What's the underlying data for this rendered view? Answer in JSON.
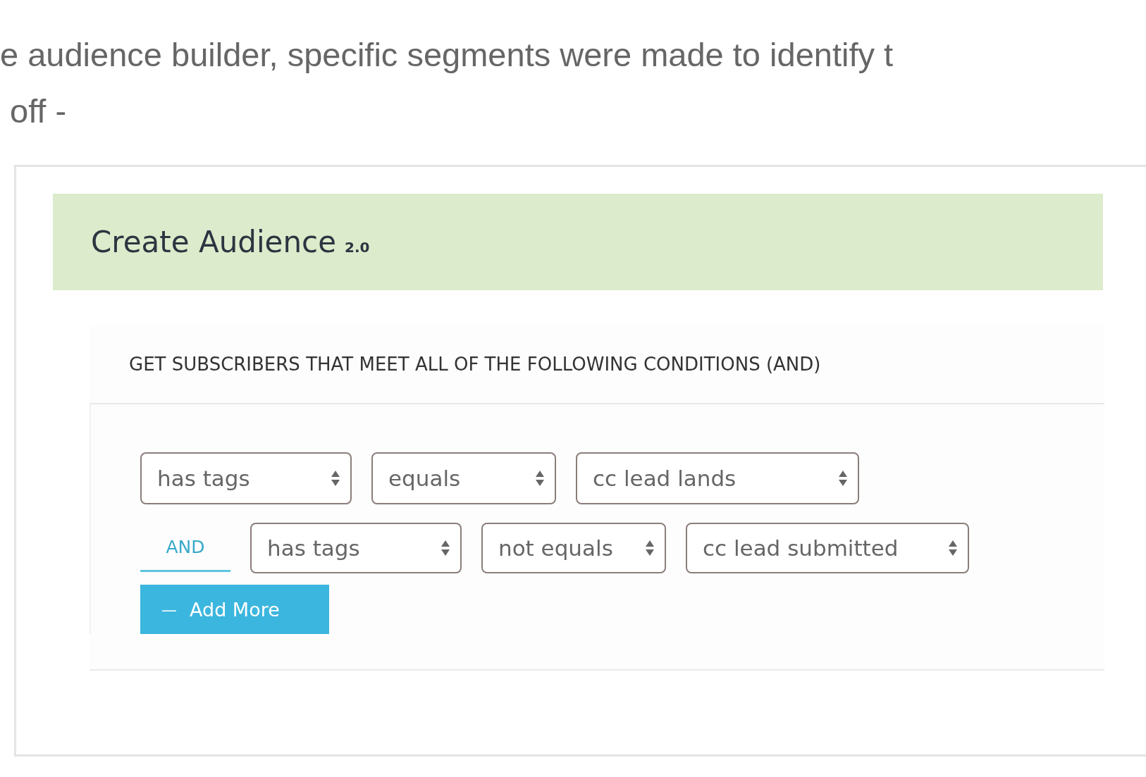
{
  "intro_text": [
    "e audience builder, specific segments were made to identify t",
    "off -"
  ],
  "panel": {
    "title": "Create Audience",
    "version": "2.0",
    "conditions_heading": "GET SUBSCRIBERS THAT MEET ALL OF THE FOLLOWING CONDITIONS (AND)",
    "conditions": [
      {
        "field": "has tags",
        "operator": "equals",
        "value": "cc lead lands"
      },
      {
        "connector": "AND",
        "field": "has tags",
        "operator": "not equals",
        "value": "cc lead submitted"
      }
    ],
    "add_button": {
      "icon": "—",
      "label": "Add More"
    }
  }
}
